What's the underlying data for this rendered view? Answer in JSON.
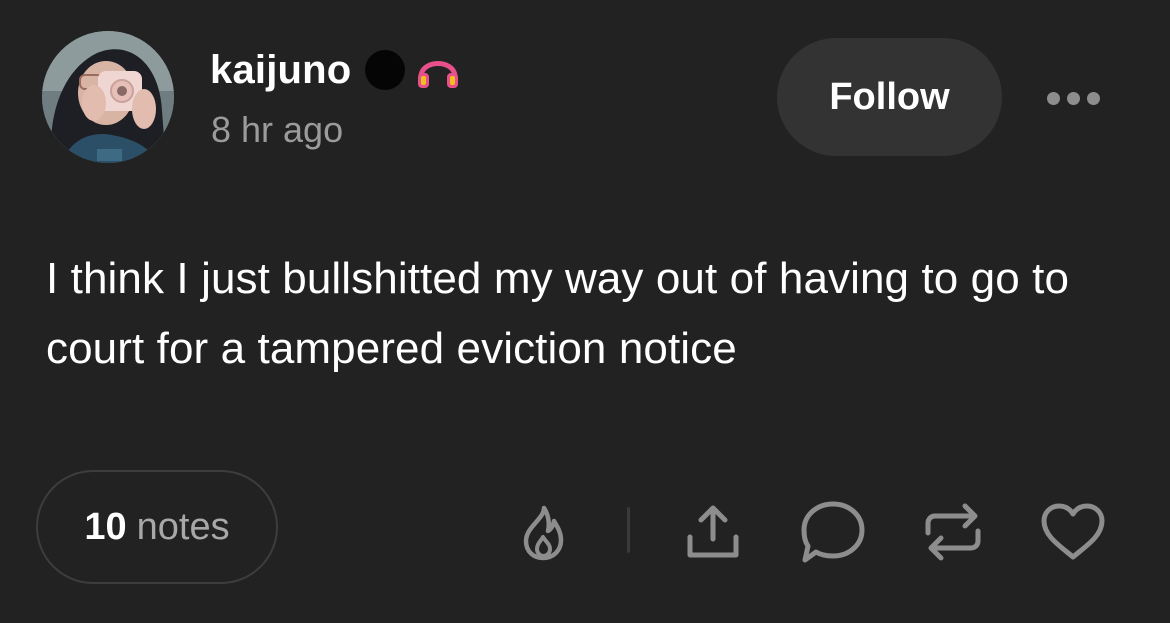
{
  "post": {
    "author": {
      "username": "kaijuno",
      "badges": [
        "black-dot-badge",
        "headphones-icon"
      ]
    },
    "timestamp": "8 hr ago",
    "follow_label": "Follow",
    "more_icon": "more-dots-icon",
    "text": "I think I just bullshitted my way out of having to go to court for a tampered eviction notice",
    "notes": {
      "count": "10",
      "label": "notes"
    },
    "actions": [
      "flame-icon",
      "share-icon",
      "comment-icon",
      "reblog-icon",
      "heart-icon"
    ]
  },
  "colors": {
    "background": "#222222",
    "button_bg": "#333333",
    "muted_text": "#9b9b9b",
    "icon_gray": "#8d8d8d",
    "headphones_pink": "#e8508c",
    "headphones_yellow": "#f2c01e"
  }
}
